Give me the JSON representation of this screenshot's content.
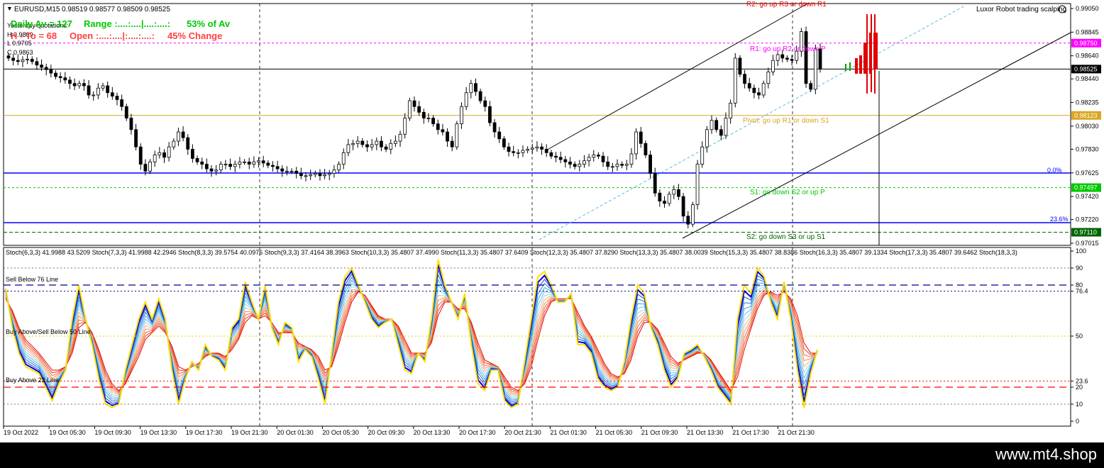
{
  "header": {
    "symbol": "EURUSD,M15",
    "ohlc": "0.98519 0.98577 0.98509 0.98525",
    "robot": "Luxor Robot trading scalping"
  },
  "info": {
    "daily_av": "Daily Av = 127",
    "range_label": "Range :....:....|....:....:",
    "range_pct": "53% of Av",
    "yesterday": "Yesterday quotations:",
    "h": "H 0.9869",
    "l": "L 0.9705",
    "c": "C 0.9863",
    "to": "H - To = 68",
    "open_label": "Open :....:....|:....:....:",
    "change": "45% Change"
  },
  "levels": {
    "r2": "R2: go up R3 or down R1",
    "r1": "R1: go up R2 or down P",
    "pivot": "Pivot: go up R1 or down S1",
    "s1": "S1: go down S2 or up P",
    "s2": "S2: go down S3 or up S1",
    "fib0": "0.0%",
    "fib236": "23.6%"
  },
  "price_axis": {
    "ticks": [
      "0.99050",
      "0.98845",
      "0.98640",
      "0.98440",
      "0.98235",
      "0.98030",
      "0.97830",
      "0.97625",
      "0.97420",
      "0.97220",
      "0.97015"
    ],
    "ticks_values": [
      0.9905,
      0.98845,
      0.9864,
      0.9844,
      0.98235,
      0.9803,
      0.9783,
      0.97625,
      0.9742,
      0.9722,
      0.97015
    ],
    "badges": [
      {
        "label": "0.98750",
        "value": 0.9875,
        "color": "#ff00ff"
      },
      {
        "label": "0.98525",
        "value": 0.98525,
        "color": "#000000"
      },
      {
        "label": "0.98123",
        "value": 0.98123,
        "color": "#daa520"
      },
      {
        "label": "0.97497",
        "value": 0.97497,
        "color": "#00c800"
      },
      {
        "label": "0.97110",
        "value": 0.9711,
        "color": "#006400"
      }
    ]
  },
  "stoch_header": "Stoch(6,3,3) 41.9988 43.5209  Stoch(7,3,3) 41.9988 42.2946  Stoch(8,3,3) 39.5754 40.0976  Stoch(9,3,3) 37.4164 38.3963  Stoch(10,3,3) 35.4807 37.4990  Stoch(11,3,3) 35.4807 37.6409  Stoch(12,3,3) 35.4807 37.8290  Stoch(13,3,3) 35.4807 38.0039  Stoch(15,3,3) 35.4807 38.8386  Stoch(16,3,3) 35.4807 39.1334  Stoch(17,3,3) 35.4807 39.6462  Stoch(18,3,3)",
  "stoch_labels": {
    "sell76": "Sell Below 76 Line",
    "mid50": "Buy Above/Sell Below 50 Line",
    "buy23": "Buy Above 23 Line"
  },
  "stoch_axis": {
    "ticks": [
      "100",
      "90",
      "80",
      "76.4",
      "50",
      "23.6",
      "20",
      "10",
      "0"
    ],
    "values": [
      100,
      90,
      80,
      76.4,
      50,
      23.6,
      20,
      10,
      0
    ]
  },
  "time_axis": [
    "19 Oct 2022",
    "19 Oct 05:30",
    "19 Oct 09:30",
    "19 Oct 13:30",
    "19 Oct 17:30",
    "19 Oct 21:30",
    "20 Oct 01:30",
    "20 Oct 05:30",
    "20 Oct 09:30",
    "20 Oct 13:30",
    "20 Oct 17:30",
    "20 Oct 21:30",
    "21 Oct 01:30",
    "21 Oct 05:30",
    "21 Oct 09:30",
    "21 Oct 13:30",
    "21 Oct 17:30",
    "21 Oct 21:30"
  ],
  "footer": "www.mt4.shop",
  "colors": {
    "bull": "#000000",
    "bear": "#000000",
    "fib_line": "#0000ff",
    "r_line": "#ff00ff",
    "pivot_line": "#daa520",
    "s1_line": "#00c800",
    "s2_line": "#006400",
    "info_green": "#00c800",
    "info_red": "#ff4040"
  },
  "chart_data": [
    {
      "type": "candlestick",
      "title": "EURUSD,M15",
      "ylim": [
        0.97015,
        0.9905
      ],
      "series": [
        {
          "name": "EURUSD",
          "close": [
            0.9862,
            0.986,
            0.9859,
            0.98605,
            0.9861,
            0.9859,
            0.9856,
            0.9854,
            0.9852,
            0.9849,
            0.9846,
            0.9845,
            0.9843,
            0.984,
            0.9838,
            0.984,
            0.9838,
            0.983,
            0.983,
            0.9836,
            0.9838,
            0.9832,
            0.9829,
            0.9826,
            0.982,
            0.981,
            0.98,
            0.9785,
            0.977,
            0.9764,
            0.9772,
            0.9778,
            0.978,
            0.9776,
            0.9785,
            0.979,
            0.9798,
            0.9793,
            0.9783,
            0.9775,
            0.9772,
            0.977,
            0.9766,
            0.9764,
            0.9765,
            0.977,
            0.977,
            0.9768,
            0.977,
            0.9772,
            0.9772,
            0.977,
            0.9772,
            0.9773,
            0.9771,
            0.9769,
            0.9768,
            0.9766,
            0.9764,
            0.9764,
            0.9764,
            0.9762,
            0.976,
            0.976,
            0.9761,
            0.9762,
            0.976,
            0.9761,
            0.9762,
            0.9765,
            0.977,
            0.978,
            0.9787,
            0.9788,
            0.979,
            0.9787,
            0.9785,
            0.9787,
            0.979,
            0.9785,
            0.9783,
            0.9788,
            0.979,
            0.9796,
            0.981,
            0.9825,
            0.982,
            0.9815,
            0.981,
            0.981,
            0.9805,
            0.98,
            0.9798,
            0.979,
            0.9785,
            0.9805,
            0.982,
            0.9832,
            0.984,
            0.9833,
            0.9825,
            0.982,
            0.9806,
            0.9798,
            0.9792,
            0.9785,
            0.9781,
            0.978,
            0.978,
            0.9782,
            0.9783,
            0.9784,
            0.9785,
            0.9783,
            0.978,
            0.9777,
            0.9776,
            0.9774,
            0.9772,
            0.977,
            0.9768,
            0.977,
            0.9773,
            0.9776,
            0.9778,
            0.9777,
            0.9772,
            0.9768,
            0.9768,
            0.977,
            0.9769,
            0.977,
            0.9779,
            0.9798,
            0.9788,
            0.9778,
            0.9762,
            0.9745,
            0.9738,
            0.9736,
            0.9744,
            0.9748,
            0.9742,
            0.9725,
            0.9718,
            0.9735,
            0.977,
            0.9785,
            0.98,
            0.9808,
            0.98,
            0.9795,
            0.981,
            0.9823,
            0.9862,
            0.9848,
            0.984,
            0.9836,
            0.9832,
            0.983,
            0.984,
            0.985,
            0.986,
            0.9865,
            0.9862,
            0.9861,
            0.986,
            0.9868,
            0.9885,
            0.984,
            0.9835,
            0.987,
            0.98525
          ]
        }
      ],
      "markers": {
        "price": 0.98525,
        "r1": 0.9875,
        "pivot": 0.98123,
        "s1": 0.97497,
        "s2": 0.9711
      }
    },
    {
      "type": "line",
      "title": "Stoch(6..18,3,3)",
      "ylim": [
        0,
        100
      ],
      "levels": [
        76.4,
        50,
        23.6
      ],
      "series": [
        {
          "name": "Stoch(6,3,3)",
          "values": [
            78,
            55,
            40,
            32,
            30,
            28,
            20,
            12,
            22,
            30,
            60,
            80,
            60,
            45,
            25,
            10,
            8,
            10,
            30,
            45,
            60,
            70,
            60,
            72,
            60,
            30,
            10,
            25,
            35,
            30,
            45,
            38,
            36,
            30,
            55,
            60,
            82,
            70,
            60,
            80,
            55,
            45,
            58,
            55,
            35,
            42,
            38,
            25,
            10,
            40,
            70,
            85,
            90,
            80,
            70,
            60,
            55,
            58,
            60,
            45,
            30,
            28,
            40,
            35,
            60,
            95,
            80,
            70,
            60,
            75,
            45,
            22,
            18,
            30,
            30,
            12,
            8,
            10,
            35,
            60,
            85,
            88,
            80,
            70,
            70,
            75,
            45,
            45,
            40,
            25,
            20,
            18,
            20,
            35,
            60,
            80,
            75,
            55,
            45,
            30,
            20,
            25,
            40,
            42,
            45,
            38,
            30,
            20,
            15,
            10,
            60,
            80,
            75,
            90,
            85,
            70,
            60,
            82,
            60,
            30,
            8,
            28,
            42
          ]
        },
        {
          "name": "Stoch(18,3,3)",
          "values": [
            72,
            65,
            55,
            48,
            44,
            40,
            35,
            30,
            30,
            32,
            40,
            55,
            58,
            52,
            42,
            30,
            22,
            18,
            22,
            30,
            38,
            48,
            52,
            56,
            52,
            44,
            32,
            30,
            32,
            34,
            38,
            40,
            40,
            38,
            42,
            48,
            58,
            62,
            60,
            62,
            58,
            52,
            52,
            52,
            46,
            44,
            42,
            38,
            30,
            32,
            44,
            58,
            70,
            76,
            74,
            68,
            62,
            60,
            60,
            56,
            48,
            40,
            40,
            40,
            46,
            62,
            70,
            70,
            66,
            66,
            58,
            46,
            36,
            34,
            32,
            26,
            20,
            18,
            22,
            32,
            48,
            62,
            70,
            72,
            72,
            72,
            64,
            56,
            50,
            42,
            34,
            28,
            26,
            28,
            36,
            50,
            58,
            58,
            54,
            46,
            38,
            34,
            36,
            38,
            40,
            40,
            36,
            30,
            24,
            18,
            26,
            42,
            54,
            66,
            74,
            76,
            74,
            76,
            72,
            62,
            46,
            40,
            40
          ]
        }
      ]
    }
  ]
}
